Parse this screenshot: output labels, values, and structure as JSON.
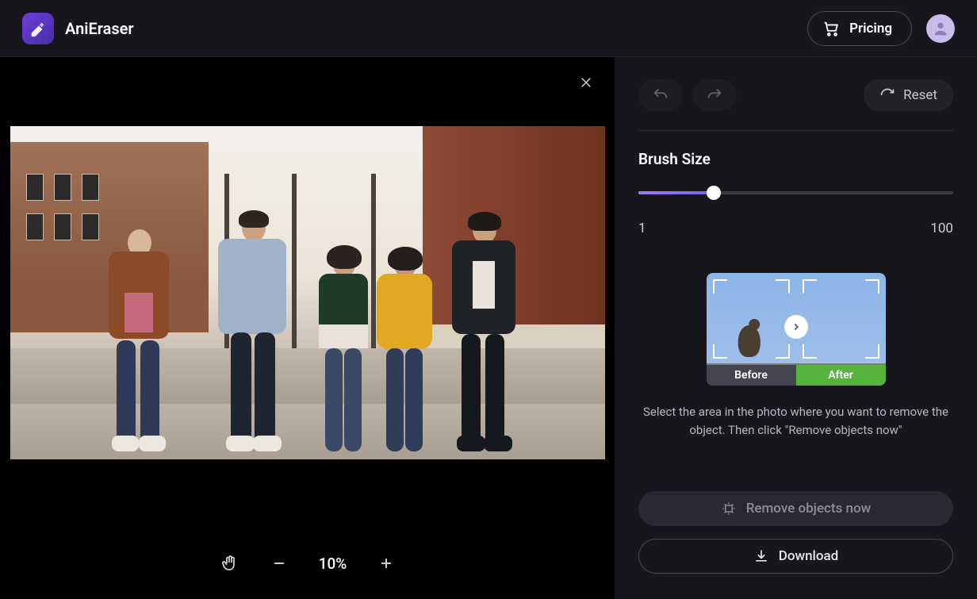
{
  "header": {
    "brand": "AniEraser",
    "pricing_label": "Pricing"
  },
  "canvas": {
    "zoom": "10%"
  },
  "panel": {
    "reset_label": "Reset",
    "brush_section_title": "Brush Size",
    "slider_min": "1",
    "slider_max": "100",
    "preview_before": "Before",
    "preview_after": "After",
    "instructions": "Select the area in the photo where you want to remove the object. Then click \"Remove objects now\"",
    "remove_label": "Remove objects now",
    "download_label": "Download"
  },
  "colors": {
    "accent": "#7a5feb"
  }
}
